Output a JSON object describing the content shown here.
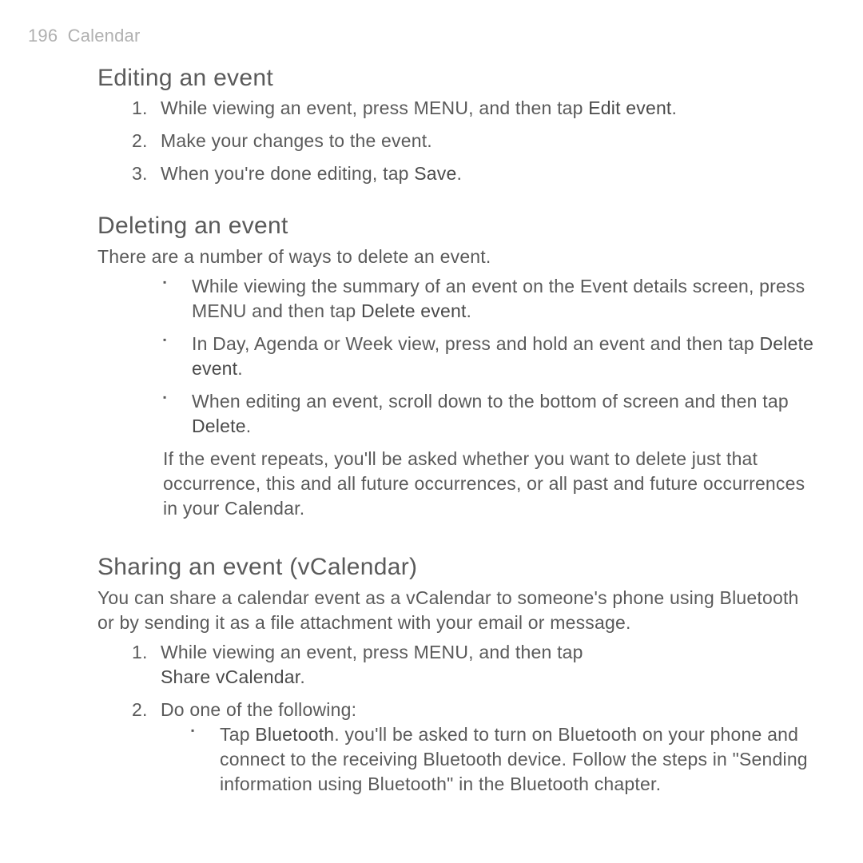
{
  "header": {
    "page_number": "196",
    "chapter": "Calendar"
  },
  "section_edit": {
    "heading": "Editing an event",
    "steps": [
      {
        "pre": "While viewing an event, press MENU, and then tap ",
        "bold": "Edit event",
        "post": "."
      },
      {
        "pre": "Make your changes to the event.",
        "bold": "",
        "post": ""
      },
      {
        "pre": "When you're done editing, tap ",
        "bold": "Save",
        "post": "."
      }
    ]
  },
  "section_delete": {
    "heading": "Deleting an event",
    "intro": "There are a number of ways to delete an event.",
    "bullets": [
      {
        "pre": "While viewing the summary of an event on the Event details screen, press MENU and then tap ",
        "bold": "Delete event",
        "post": "."
      },
      {
        "pre": "In Day, Agenda or Week view, press and hold an event and then tap ",
        "bold": "Delete event",
        "post": "."
      },
      {
        "pre": "When editing an event, scroll down to the bottom of screen and then tap ",
        "bold": "Delete",
        "post": "."
      }
    ],
    "follow": "If the event repeats, you'll be asked whether you want to delete just that occurrence, this and all future occurrences, or all past and future occurrences in your Calendar."
  },
  "section_share": {
    "heading": "Sharing an event (vCalendar)",
    "intro": "You can share a calendar event as a vCalendar to someone's phone using Bluetooth or by sending it as a file attachment with your email or message.",
    "step1": {
      "pre": "While viewing an event, press MENU, and then tap ",
      "bold": "Share vCalendar",
      "post": "."
    },
    "step2": "Do one of the following:",
    "sub_bullet": {
      "pre": "Tap ",
      "bold": "Bluetooth",
      "post": ". you'll be asked to turn on Bluetooth on your phone and connect to the receiving Bluetooth device. Follow the steps in \"Sending information using Bluetooth\" in the Bluetooth chapter."
    }
  }
}
